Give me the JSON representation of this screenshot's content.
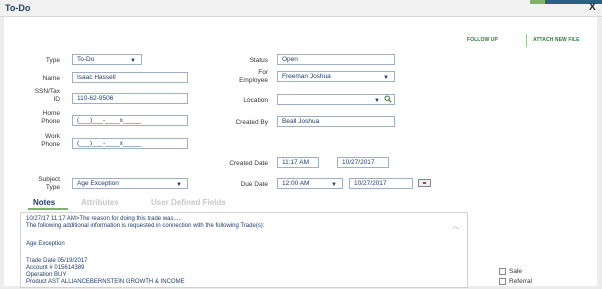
{
  "window": {
    "title": "To-Do",
    "close_glyph": "X"
  },
  "actions": {
    "follow_up": "FOLLOW UP",
    "attach_file": "ATTACH NEW FILE"
  },
  "form": {
    "type": {
      "label": "Type",
      "value": "To-Do"
    },
    "name": {
      "label": "Name",
      "value": "Isaac Hassell"
    },
    "ssn": {
      "label_line1": "SSN/Tax",
      "label_line2": "ID",
      "value": "110-62-9506"
    },
    "home_phone": {
      "label_line1": "Home",
      "label_line2": "Phone",
      "value": "(___)___-____x_____"
    },
    "work_phone": {
      "label_line1": "Work",
      "label_line2": "Phone",
      "value": "(___)___-____x_____"
    },
    "subject_type": {
      "label_line1": "Subject",
      "label_line2": "Type",
      "value": "Age Exception"
    },
    "status": {
      "label": "Status",
      "value": "Open"
    },
    "for_employee": {
      "label_line1": "For",
      "label_line2": "Employee",
      "value": "Freeman Joshua"
    },
    "location": {
      "label": "Location",
      "value": ""
    },
    "created_by": {
      "label": "Created By",
      "value": "Beall Joshua"
    },
    "created_date": {
      "label": "Created Date",
      "time": "11:17 AM",
      "date": "10/27/2017"
    },
    "due_date": {
      "label": "Due Date",
      "time": "12:00 AM",
      "date": "10/27/2017"
    }
  },
  "tabs": {
    "notes": "Notes",
    "attributes": "Attributes",
    "user_defined": "User Defined Fields"
  },
  "notes": {
    "lines": [
      "10/27/17 11:17 AM>The reason for doing this trade was.....",
      "The following additional information is requested in connection with the following Trade(s):",
      "",
      "Age Exception",
      "",
      "Trade Date 05/19/2017",
      "Account #  015614389",
      "Operation  BUY",
      "Product    AST ALLIANCEBERNSTEIN GROWTH & INCOME"
    ]
  },
  "checkboxes": {
    "sale": "Sale",
    "referral": "Referral"
  },
  "icons": {
    "dropdown": "caret-down-icon",
    "search": "magnifier-icon",
    "calendar": "calendar-icon",
    "scroll": "scroll-up-icon"
  },
  "colors": {
    "label_blue": "#1f3d6d",
    "accent_green": "#2d7c3a",
    "border": "#9fb0c4"
  }
}
